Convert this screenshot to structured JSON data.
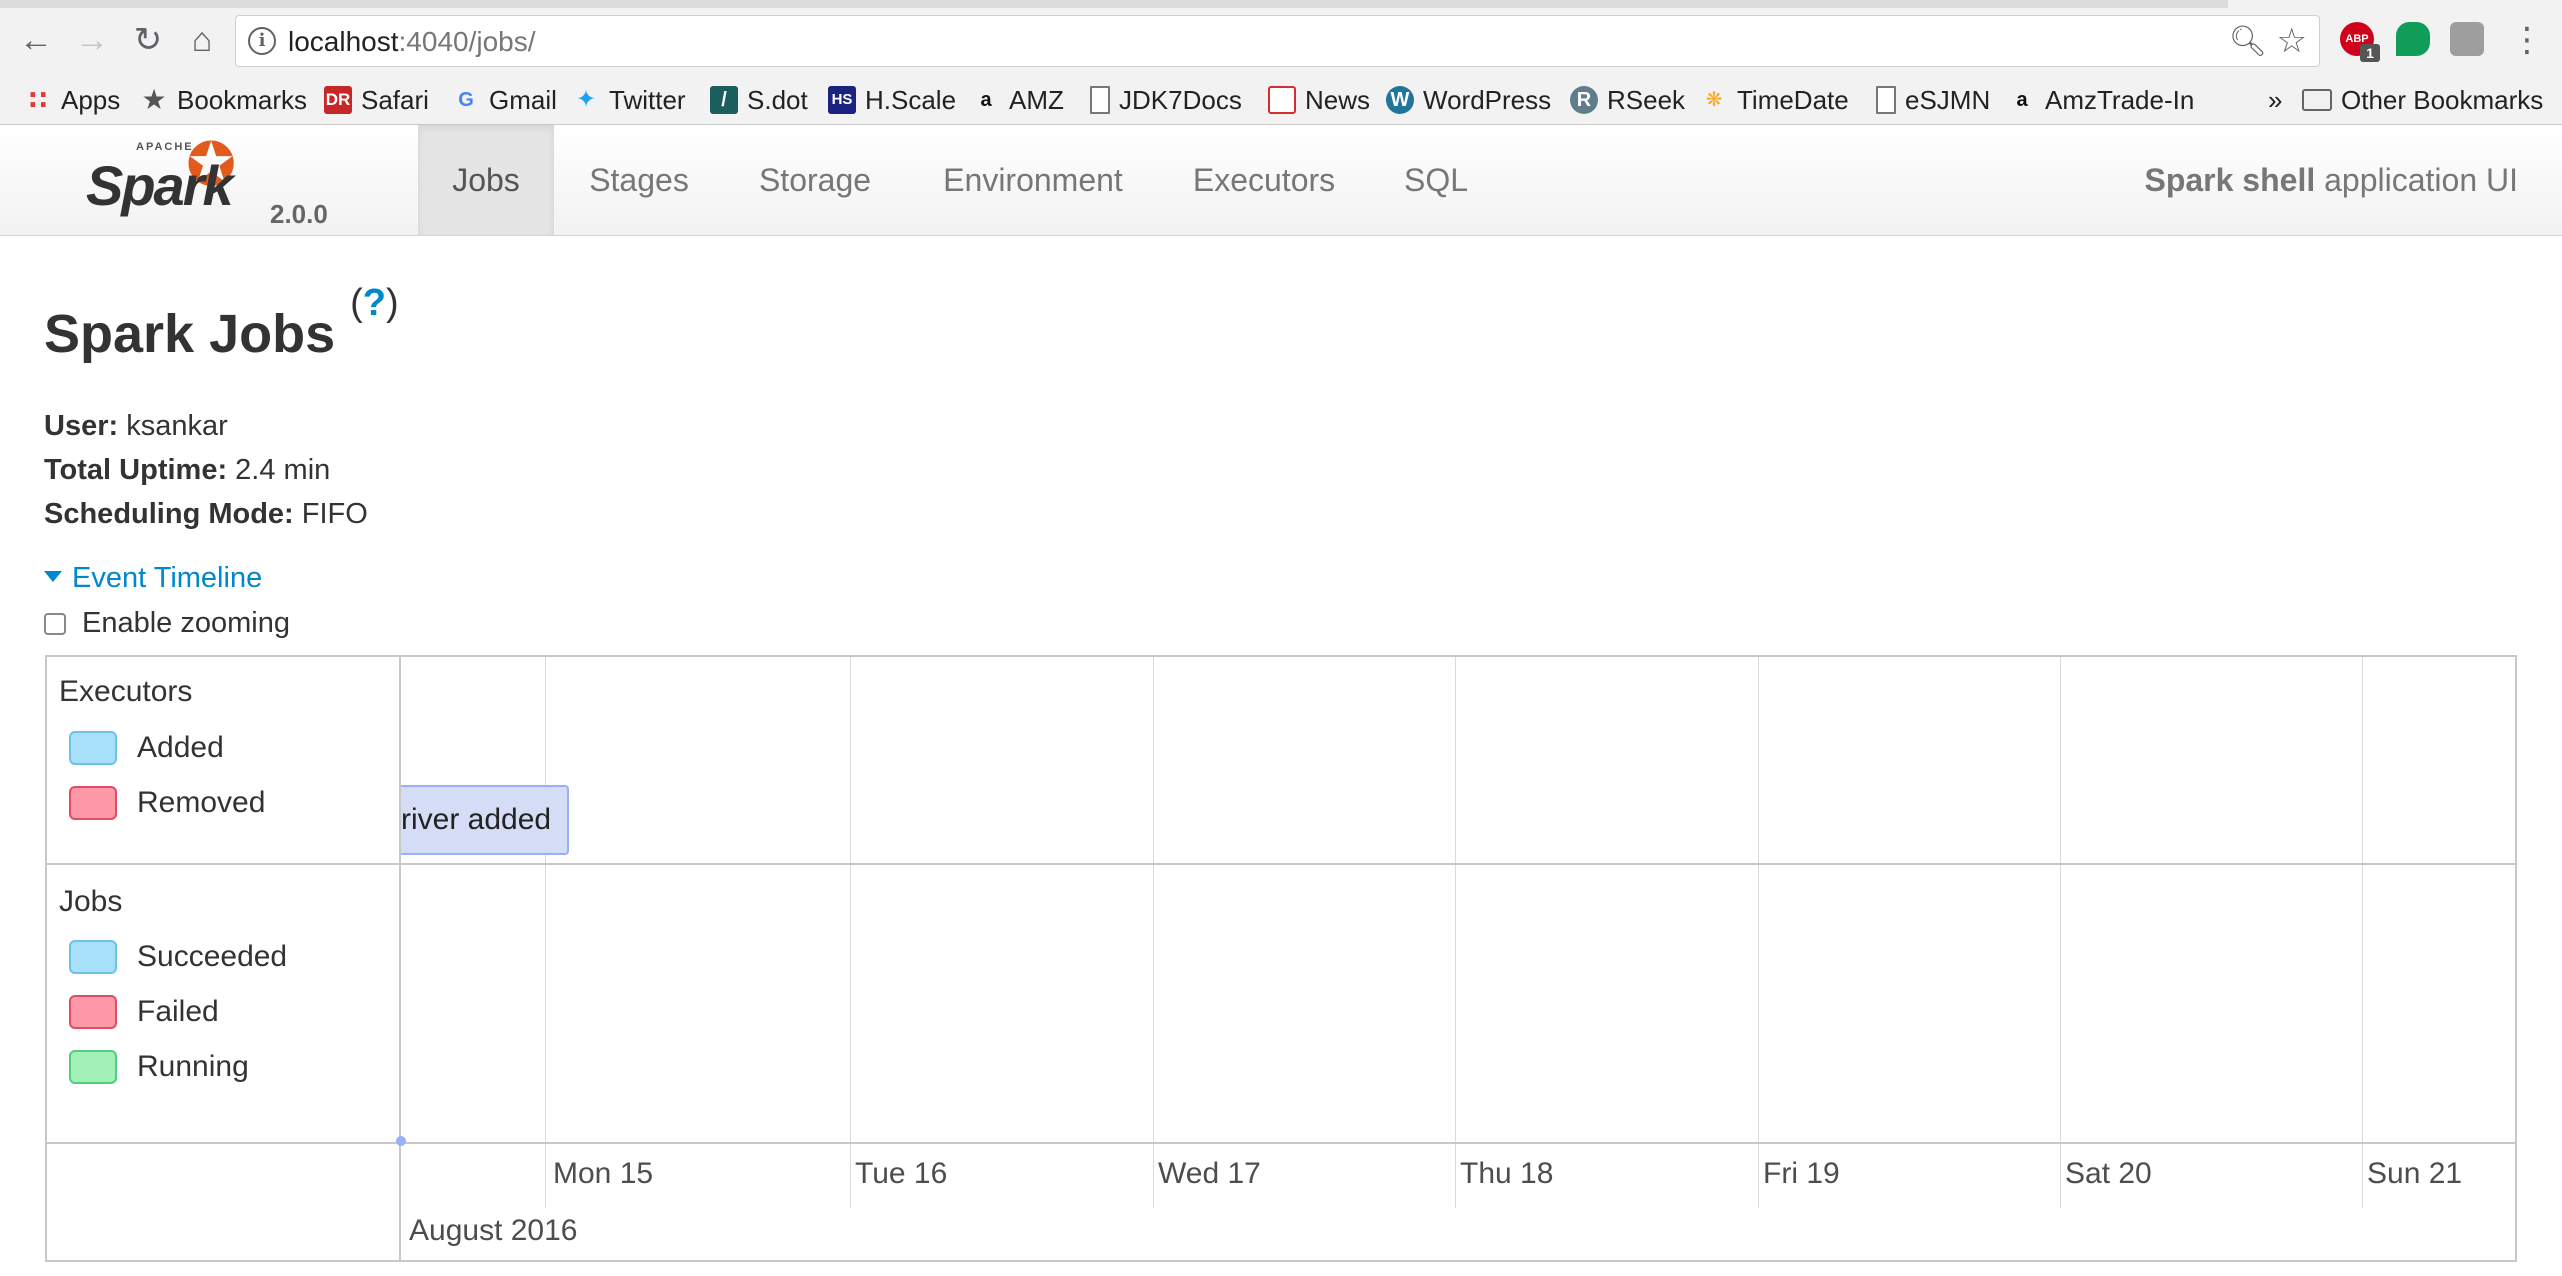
{
  "browser": {
    "url_host": "localhost",
    "url_rest": ":4040/jobs/",
    "abp_badge": "1",
    "bookmarks": [
      {
        "label": "Apps",
        "icon": "apps-grid-icon",
        "color": "#e53935"
      },
      {
        "label": "Bookmarks",
        "icon": "star-icon",
        "color": "#555555"
      },
      {
        "label": "Safari",
        "icon": "safari-icon",
        "color": "#c62828"
      },
      {
        "label": "Gmail",
        "icon": "google-icon",
        "color": "#4285f4"
      },
      {
        "label": "Twitter",
        "icon": "twitter-icon",
        "color": "#1da1f2"
      },
      {
        "label": "S.dot",
        "icon": "sdot-icon",
        "color": "#1b5e5e"
      },
      {
        "label": "H.Scale",
        "icon": "hscale-icon",
        "color": "#1a237e"
      },
      {
        "label": "AMZ",
        "icon": "amazon-icon",
        "color": "#111111"
      },
      {
        "label": "JDK7Docs",
        "icon": "page-icon",
        "color": "#777777"
      },
      {
        "label": "News",
        "icon": "news-icon",
        "color": "#d32f2f"
      },
      {
        "label": "WordPress",
        "icon": "wordpress-icon",
        "color": "#21759b"
      },
      {
        "label": "RSeek",
        "icon": "rseek-icon",
        "color": "#607d8b"
      },
      {
        "label": "TimeDate",
        "icon": "timedate-icon",
        "color": "#f9a825"
      },
      {
        "label": "eSJMN",
        "icon": "page-icon",
        "color": "#777777"
      },
      {
        "label": "AmzTrade-In",
        "icon": "amazon-icon",
        "color": "#111111"
      }
    ],
    "overflow": "»",
    "other_bookmarks": "Other Bookmarks"
  },
  "navbar": {
    "logo_small": "APACHE",
    "logo_word": "Spark",
    "version": "2.0.0",
    "tabs": [
      "Jobs",
      "Stages",
      "Storage",
      "Environment",
      "Executors",
      "SQL"
    ],
    "active_tab": "Jobs",
    "app_name": "Spark shell",
    "app_suffix": " application UI"
  },
  "page": {
    "title": "Spark Jobs",
    "help": "?",
    "user_label": "User:",
    "user": " ksankar",
    "uptime_label": "Total Uptime:",
    "uptime": " 2.4 min",
    "mode_label": "Scheduling Mode:",
    "mode": " FIFO",
    "event_timeline": "Event Timeline",
    "enable_zooming": "Enable zooming"
  },
  "timeline": {
    "executors_title": "Executors",
    "executors_legend": [
      "Added",
      "Removed"
    ],
    "jobs_title": "Jobs",
    "jobs_legend": [
      "Succeeded",
      "Failed",
      "Running"
    ],
    "event_label": "river added",
    "ticks": [
      "Mon 15",
      "Tue 16",
      "Wed 17",
      "Thu 18",
      "Fri 19",
      "Sat 20",
      "Sun 21"
    ],
    "major_label": "August 2016",
    "colors": {
      "added": "#a8e0fa",
      "removed": "#ff98a8",
      "running": "#a0f0b8",
      "event": "#d5ddf6"
    }
  }
}
